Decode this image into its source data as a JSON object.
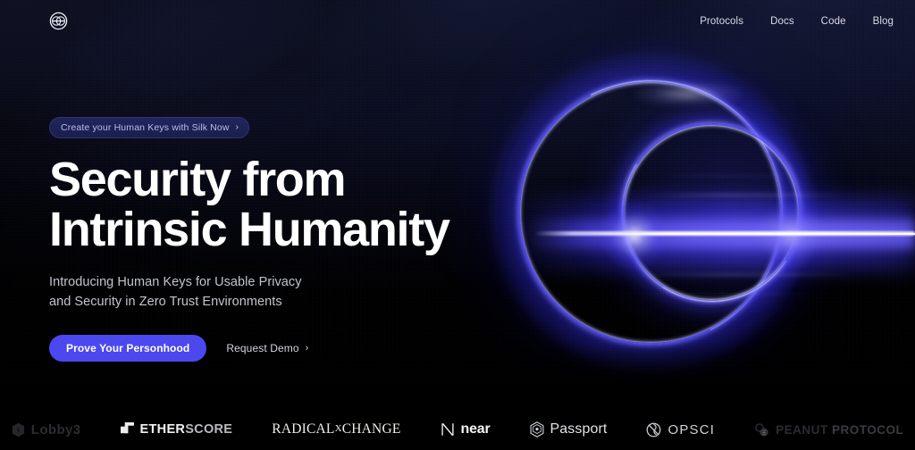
{
  "brand": {
    "logo_icon": "holonym-ring-logo-icon"
  },
  "nav": {
    "links": [
      {
        "label": "Protocols"
      },
      {
        "label": "Docs"
      },
      {
        "label": "Code"
      },
      {
        "label": "Blog"
      }
    ]
  },
  "hero": {
    "badge": {
      "label": "Create your Human Keys with Silk Now",
      "chevron": "›",
      "icon": "chevron-right-icon"
    },
    "headline": "Security from\nIntrinsic Humanity",
    "subheadline": "Introducing Human Keys for Usable Privacy\nand Security in Zero Trust Environments",
    "primary_cta": "Prove Your Personhood",
    "secondary_cta": "Request Demo",
    "secondary_cta_chevron": "›",
    "graphic": "glowing-blue-ring-beam-graphic"
  },
  "partners": {
    "items": [
      {
        "name": "Lobby3",
        "icon": "lobby3-hex-icon",
        "dim": true
      },
      {
        "name": "ETHER",
        "name_light": "SCORE",
        "icon": "etherscore-cube-icon",
        "dim": false
      },
      {
        "name": "RADICAL",
        "name_sup": "X",
        "name_rest": "CHANGE",
        "icon": "",
        "dim": false
      },
      {
        "name": "near",
        "icon": "near-n-icon",
        "dim": false
      },
      {
        "name": "Passport",
        "icon": "passport-hex-icon",
        "dim": false
      },
      {
        "name": "OPSCI",
        "icon": "opsci-circle-icon",
        "dim": false
      },
      {
        "name": "PEANUT",
        "name_light": "PROTOCOL",
        "icon": "peanut-icon",
        "dim": true
      }
    ]
  },
  "colors": {
    "background": "#000000",
    "background_top": "#1b2046",
    "accent_blue": "#4b48ef",
    "glow_blue": "#5c54ff",
    "badge_text": "#b9bdf2",
    "heading_text": "#ffffff",
    "body_text": "#c2c4cc"
  }
}
